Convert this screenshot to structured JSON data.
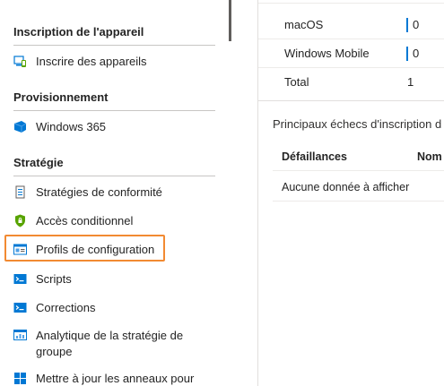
{
  "nav": {
    "sections": [
      {
        "title": "Inscription de l'appareil",
        "items": [
          {
            "label": "Inscrire des appareils",
            "icon": "enroll-devices-icon"
          }
        ]
      },
      {
        "title": "Provisionnement",
        "items": [
          {
            "label": "Windows 365",
            "icon": "windows365-icon"
          }
        ]
      },
      {
        "title": "Stratégie",
        "items": [
          {
            "label": "Stratégies de conformité",
            "icon": "compliance-policy-icon"
          },
          {
            "label": "Accès conditionnel",
            "icon": "conditional-access-icon"
          },
          {
            "label": "Profils de configuration",
            "icon": "configuration-profile-icon",
            "highlighted": true
          },
          {
            "label": "Scripts",
            "icon": "scripts-icon"
          },
          {
            "label": "Corrections",
            "icon": "remediations-icon"
          },
          {
            "label": "Analytique de la stratégie de groupe",
            "icon": "group-policy-analytics-icon"
          },
          {
            "label": "Mettre à jour les anneaux pour",
            "icon": "update-rings-icon"
          }
        ]
      }
    ]
  },
  "platform_table": {
    "rows": [
      {
        "name": "macOS",
        "value": "0"
      },
      {
        "name": "Windows Mobile",
        "value": "0"
      },
      {
        "name": "Total",
        "value": "1"
      }
    ]
  },
  "enrollment_failures": {
    "title": "Principaux échecs d'inscription d",
    "headers": [
      "Défaillances",
      "Nom"
    ],
    "empty_message": "Aucune donnée à afficher"
  },
  "colors": {
    "highlight": "#f28a32",
    "accent": "#0078d4"
  }
}
